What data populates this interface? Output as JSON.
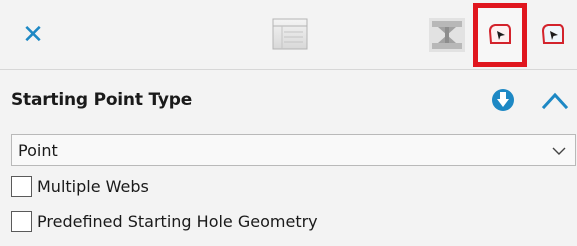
{
  "toolbar": {
    "close_icon": "close-icon",
    "close_color": "#1d88c4",
    "highlight_color": "#e0161e",
    "icons": [
      "table-icon",
      "weld-icon",
      "starting-point-icon",
      "starting-point-alt-icon"
    ]
  },
  "section": {
    "title": "Starting Point Type",
    "accent_color": "#1d88c4"
  },
  "dropdown": {
    "selected": "Point"
  },
  "options": [
    {
      "label": "Multiple Webs",
      "checked": false
    },
    {
      "label": "Predefined Starting Hole Geometry",
      "checked": false
    }
  ]
}
